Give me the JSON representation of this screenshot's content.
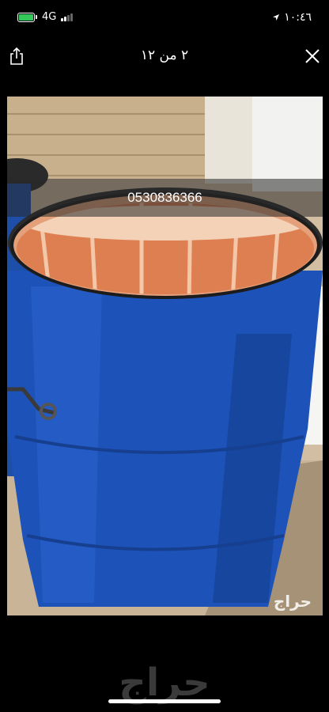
{
  "status_bar": {
    "network": "4G",
    "time": "١٠:٤٦",
    "battery_color": "#34c759"
  },
  "header": {
    "counter": "٢ من ١٢",
    "share_icon": "share-icon",
    "close_icon": "close-icon"
  },
  "photo": {
    "phone_number": "0530836366",
    "watermark": "حراج"
  },
  "footer": {
    "logo": "حراج"
  }
}
